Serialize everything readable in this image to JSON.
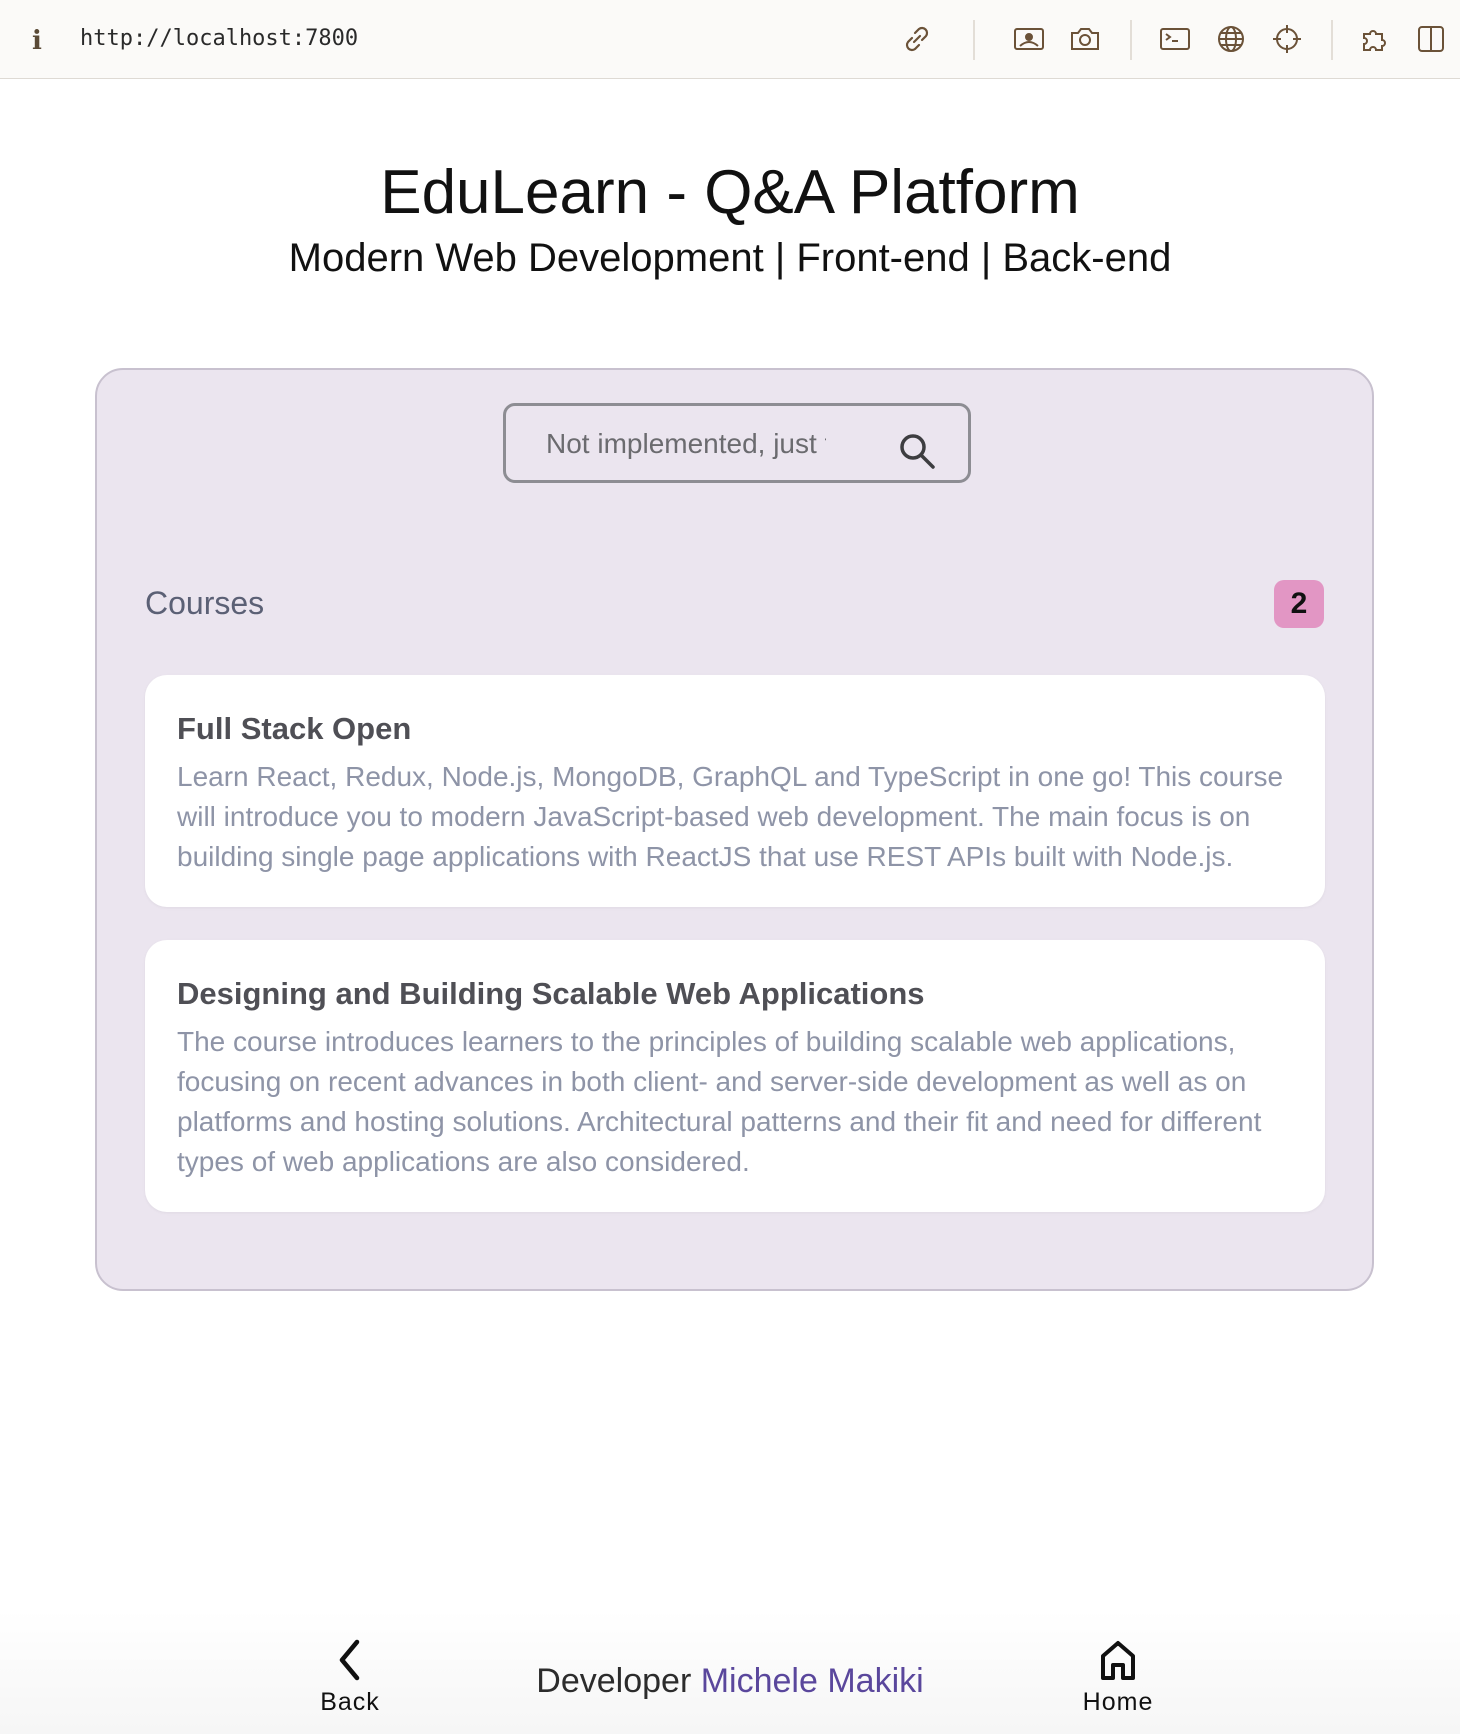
{
  "browser": {
    "url": "http://localhost:7800",
    "icons": [
      "info-icon",
      "link-icon",
      "picture-icon",
      "camera-icon",
      "terminal-icon",
      "globe-icon",
      "crosshair-icon",
      "extension-icon",
      "sidebar-icon"
    ]
  },
  "header": {
    "title": "EduLearn - Q&A Platform",
    "subtitle": "Modern Web Development | Front-end | Back-end"
  },
  "search": {
    "placeholder": "Not implemented, just for show",
    "value": ""
  },
  "courses": {
    "label": "Courses",
    "count": "2",
    "items": [
      {
        "title": "Full Stack Open",
        "description": "Learn React, Redux, Node.js, MongoDB, GraphQL and TypeScript in one go! This course will introduce you to modern JavaScript-based web development. The main focus is on building single page applications with ReactJS that use REST APIs built with Node.js."
      },
      {
        "title": "Designing and Building Scalable Web Applications",
        "description": "The course introduces learners to the principles of building scalable web applications, focusing on recent advances in both client- and server-side development as well as on platforms and hosting solutions. Architectural patterns and their fit and need for different types of web applications are also considered."
      }
    ]
  },
  "footer": {
    "back_label": "Back",
    "home_label": "Home",
    "credit_prefix": "Developer",
    "credit_name": "Michele Makiki"
  },
  "colors": {
    "panel_bg": "#ebe5ef",
    "badge_bg": "#e296c4",
    "credit_name": "#5a479c",
    "course_desc": "#8e94a7"
  }
}
